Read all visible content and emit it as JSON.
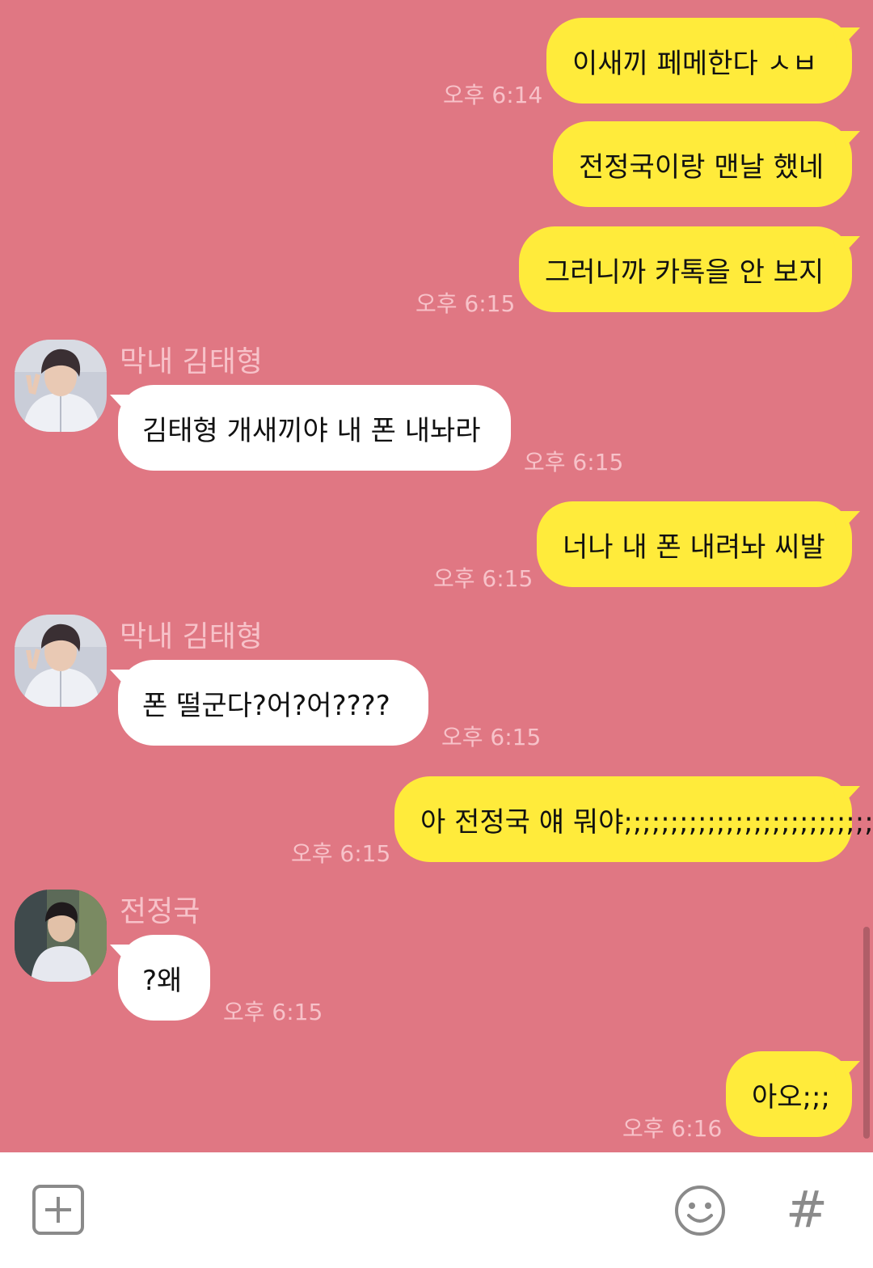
{
  "colors": {
    "background": "#e07783",
    "my_bubble": "#ffeb3b",
    "other_bubble": "#ffffff",
    "timestamp": "#f7c2c9",
    "composer": "#ffffff",
    "icon": "#8a8a8a"
  },
  "messages": [
    {
      "from": "me",
      "text": "이새끼 페메한다 ㅅㅂ",
      "time": "오후 6:14"
    },
    {
      "from": "me",
      "text": "전정국이랑 맨날 했네",
      "time": ""
    },
    {
      "from": "me",
      "text": "그러니까 카톡을 안 보지",
      "time": "오후 6:15"
    },
    {
      "from": "other",
      "sender": "막내 김태형",
      "text": "김태형 개새끼야 내 폰 내놔라",
      "time": "오후 6:15"
    },
    {
      "from": "me",
      "text": "너나 내 폰 내려놔 씨발",
      "time": "오후 6:15"
    },
    {
      "from": "other",
      "sender": "막내 김태형",
      "text": "폰 떨군다?어?어????",
      "time": "오후 6:15"
    },
    {
      "from": "me",
      "text": "아 전정국 얘 뭐야;;;;;;;;;;;;;;;;;;;;;;;;;;;",
      "time": "오후 6:15"
    },
    {
      "from": "other",
      "sender": "전정국",
      "text": "?왜",
      "time": "오후 6:15"
    },
    {
      "from": "me",
      "text": "아오;;;",
      "time": "오후 6:16"
    }
  ],
  "composer": {
    "attach_icon": "plus-square-icon",
    "emoji_icon": "smiley-icon",
    "hashtag_icon": "hash-icon",
    "hashtag_glyph": "#"
  }
}
